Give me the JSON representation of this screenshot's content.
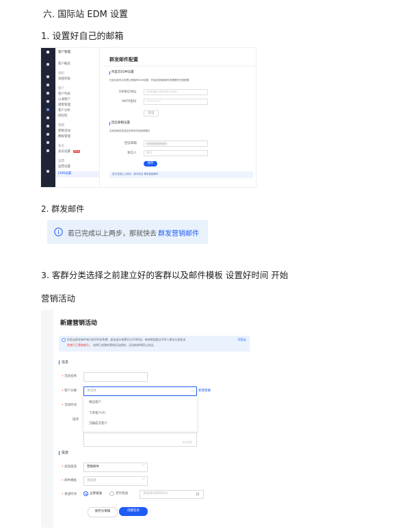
{
  "doc": {
    "section_title": "六. 国际站 EDM 设置",
    "step1": "1. 设置好自己的邮箱",
    "step2": "2. 群发邮件",
    "step3_line1": "3. 客群分类选择之前建立好的客群以及邮件模板 设置好时间    开始",
    "step3_line2": "营销活动"
  },
  "shot1": {
    "side_items": [
      "客户管理",
      "客户概览",
      "商机",
      "询盘列表",
      "客户",
      "客户列表",
      "公海客户",
      "潜客管理",
      "客户分析",
      "风险检",
      "营销",
      "营销活动",
      "模板管理",
      "会员",
      "会员设置",
      "运营",
      "运营设置",
      "EDM设置"
    ],
    "panel_title": "群发邮件配置",
    "aliyun_title": "阿里云EDM设置",
    "aliyun_desc": "在此处填写从阿里云获取的EDM设置，开始发送营销邮件前需要先完成配置",
    "dm_label": "DM发信地址",
    "dm_value": "mail@example.com",
    "smtp_label": "SMTP密码",
    "smtp_value": "••••••••",
    "verify_btn": "验证",
    "reply_title": "回信邮箱设置",
    "reply_desc": "买家回信将发送至您填写的回信邮箱中",
    "reply_mail_label": "回信邮箱",
    "sender_label": "发信人",
    "sender_value": "张三",
    "save_btn": "保存",
    "tip": "若已完成以上两步，即可前去 群发营销邮件",
    "badge": "NEW"
  },
  "tip": {
    "text": "若已完成以上两步，那就快去",
    "link": "群发营销邮件"
  },
  "shot2": {
    "title": "新建营销活动",
    "notice_text": "阿里云群发邮件每日前200封免费，超出部分收费2元/1000封，每单群组超过200人建议分批发送",
    "notice_link": "阿里云",
    "notice_line2_red": "系统只已营销账号。",
    "notice_line2": "选择已创建的营销活动规则，活动结果将停止发送。",
    "section_info": "信息",
    "name_label": "活动名称",
    "group_label": "客户分群",
    "group_placeholder": "请选择",
    "new_group": "新建客群",
    "time_label": "活动时间",
    "desc_label": "描述",
    "dropdown": [
      "精品客户",
      "下单客户(P)",
      "沉睡成交客户"
    ],
    "counter": "0/1000",
    "section_send": "投放",
    "channel_label": "投放渠道",
    "channel_value": "营销邮件",
    "template_label": "邮件模板",
    "template_placeholder": "请选择",
    "sendtime_label": "发送时间",
    "radio_now": "立即发送",
    "radio_timed": "定时发送",
    "date_placeholder": "请选择日期和时间",
    "draft_btn": "保存为草稿",
    "create_btn": "创建任务"
  },
  "colors": {
    "accent": "#1f5cf5",
    "sidebar_dark": "#1f2536",
    "tip_bg": "#e8f1fc"
  }
}
